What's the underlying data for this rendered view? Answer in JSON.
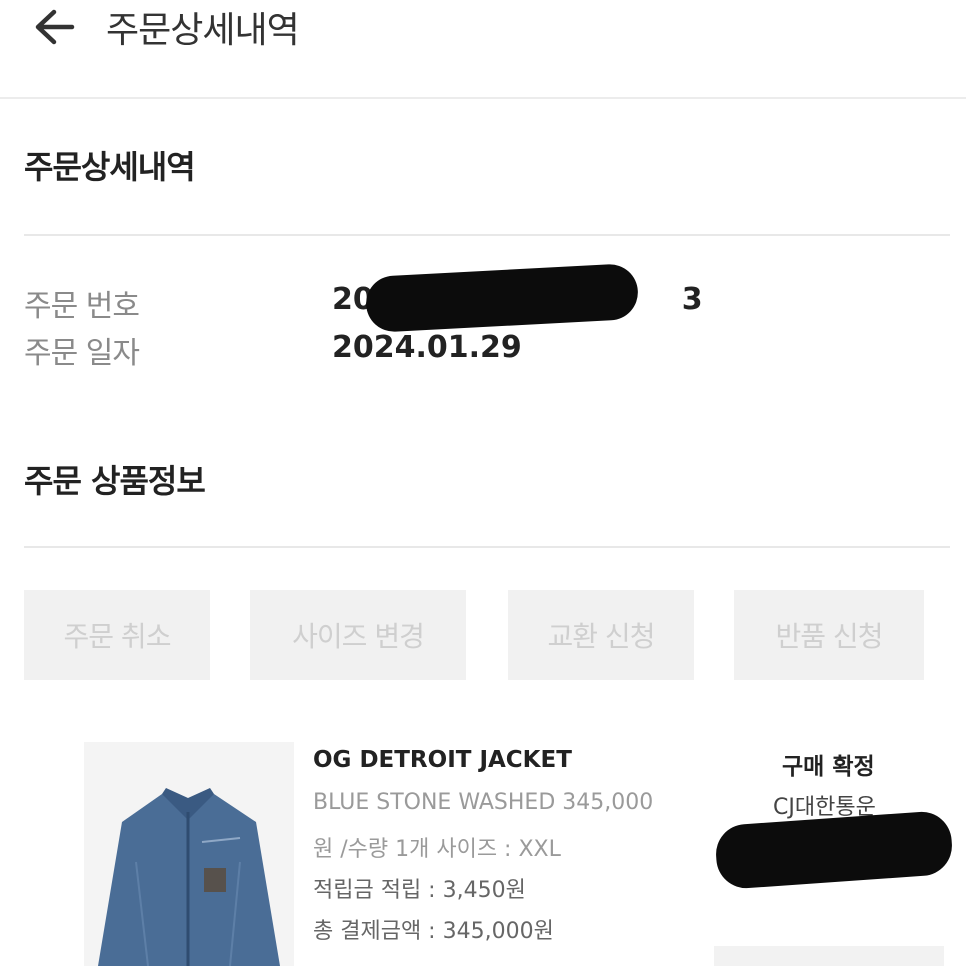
{
  "header": {
    "title": "주문상세내역"
  },
  "order_section": {
    "title": "주문상세내역",
    "number_label": "주문 번호",
    "number_visible_start": "20",
    "number_visible_end": "3",
    "date_label": "주문 일자",
    "date_value": "2024.01.29"
  },
  "product_section": {
    "title": "주문 상품정보",
    "actions": [
      {
        "label": "주문 취소"
      },
      {
        "label": "사이즈 변경"
      },
      {
        "label": "교환 신청"
      },
      {
        "label": "반품 신청"
      }
    ]
  },
  "product": {
    "name": "OG DETROIT JACKET",
    "option_line": "BLUE STONE WASHED 345,000",
    "qty_line": "원 /수량 1개 사이즈 : XXL",
    "points_line": "적립금 적립 : 3,450원",
    "total_line": "총 결제금액 : 345,000원",
    "status": "구매 확정",
    "courier": "CJ대한통운"
  },
  "colors": {
    "text_primary": "#222222",
    "text_label": "#8a8a8a",
    "text_option": "#9a9a9a",
    "button_bg": "#f1f1f1",
    "button_text": "#cfcfcf",
    "divider": "#e8e8e8",
    "denim": "#4a6d96"
  }
}
